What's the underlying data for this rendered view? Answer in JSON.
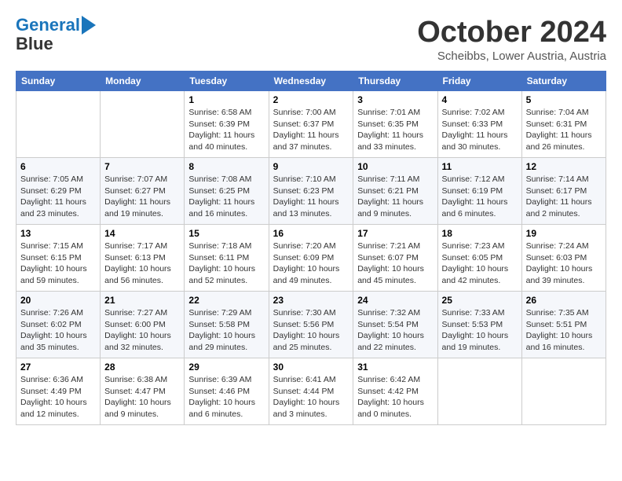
{
  "header": {
    "logo_line1": "General",
    "logo_line2": "Blue",
    "month": "October 2024",
    "location": "Scheibbs, Lower Austria, Austria"
  },
  "weekdays": [
    "Sunday",
    "Monday",
    "Tuesday",
    "Wednesday",
    "Thursday",
    "Friday",
    "Saturday"
  ],
  "weeks": [
    [
      {
        "day": "",
        "info": ""
      },
      {
        "day": "",
        "info": ""
      },
      {
        "day": "1",
        "info": "Sunrise: 6:58 AM\nSunset: 6:39 PM\nDaylight: 11 hours and 40 minutes."
      },
      {
        "day": "2",
        "info": "Sunrise: 7:00 AM\nSunset: 6:37 PM\nDaylight: 11 hours and 37 minutes."
      },
      {
        "day": "3",
        "info": "Sunrise: 7:01 AM\nSunset: 6:35 PM\nDaylight: 11 hours and 33 minutes."
      },
      {
        "day": "4",
        "info": "Sunrise: 7:02 AM\nSunset: 6:33 PM\nDaylight: 11 hours and 30 minutes."
      },
      {
        "day": "5",
        "info": "Sunrise: 7:04 AM\nSunset: 6:31 PM\nDaylight: 11 hours and 26 minutes."
      }
    ],
    [
      {
        "day": "6",
        "info": "Sunrise: 7:05 AM\nSunset: 6:29 PM\nDaylight: 11 hours and 23 minutes."
      },
      {
        "day": "7",
        "info": "Sunrise: 7:07 AM\nSunset: 6:27 PM\nDaylight: 11 hours and 19 minutes."
      },
      {
        "day": "8",
        "info": "Sunrise: 7:08 AM\nSunset: 6:25 PM\nDaylight: 11 hours and 16 minutes."
      },
      {
        "day": "9",
        "info": "Sunrise: 7:10 AM\nSunset: 6:23 PM\nDaylight: 11 hours and 13 minutes."
      },
      {
        "day": "10",
        "info": "Sunrise: 7:11 AM\nSunset: 6:21 PM\nDaylight: 11 hours and 9 minutes."
      },
      {
        "day": "11",
        "info": "Sunrise: 7:12 AM\nSunset: 6:19 PM\nDaylight: 11 hours and 6 minutes."
      },
      {
        "day": "12",
        "info": "Sunrise: 7:14 AM\nSunset: 6:17 PM\nDaylight: 11 hours and 2 minutes."
      }
    ],
    [
      {
        "day": "13",
        "info": "Sunrise: 7:15 AM\nSunset: 6:15 PM\nDaylight: 10 hours and 59 minutes."
      },
      {
        "day": "14",
        "info": "Sunrise: 7:17 AM\nSunset: 6:13 PM\nDaylight: 10 hours and 56 minutes."
      },
      {
        "day": "15",
        "info": "Sunrise: 7:18 AM\nSunset: 6:11 PM\nDaylight: 10 hours and 52 minutes."
      },
      {
        "day": "16",
        "info": "Sunrise: 7:20 AM\nSunset: 6:09 PM\nDaylight: 10 hours and 49 minutes."
      },
      {
        "day": "17",
        "info": "Sunrise: 7:21 AM\nSunset: 6:07 PM\nDaylight: 10 hours and 45 minutes."
      },
      {
        "day": "18",
        "info": "Sunrise: 7:23 AM\nSunset: 6:05 PM\nDaylight: 10 hours and 42 minutes."
      },
      {
        "day": "19",
        "info": "Sunrise: 7:24 AM\nSunset: 6:03 PM\nDaylight: 10 hours and 39 minutes."
      }
    ],
    [
      {
        "day": "20",
        "info": "Sunrise: 7:26 AM\nSunset: 6:02 PM\nDaylight: 10 hours and 35 minutes."
      },
      {
        "day": "21",
        "info": "Sunrise: 7:27 AM\nSunset: 6:00 PM\nDaylight: 10 hours and 32 minutes."
      },
      {
        "day": "22",
        "info": "Sunrise: 7:29 AM\nSunset: 5:58 PM\nDaylight: 10 hours and 29 minutes."
      },
      {
        "day": "23",
        "info": "Sunrise: 7:30 AM\nSunset: 5:56 PM\nDaylight: 10 hours and 25 minutes."
      },
      {
        "day": "24",
        "info": "Sunrise: 7:32 AM\nSunset: 5:54 PM\nDaylight: 10 hours and 22 minutes."
      },
      {
        "day": "25",
        "info": "Sunrise: 7:33 AM\nSunset: 5:53 PM\nDaylight: 10 hours and 19 minutes."
      },
      {
        "day": "26",
        "info": "Sunrise: 7:35 AM\nSunset: 5:51 PM\nDaylight: 10 hours and 16 minutes."
      }
    ],
    [
      {
        "day": "27",
        "info": "Sunrise: 6:36 AM\nSunset: 4:49 PM\nDaylight: 10 hours and 12 minutes."
      },
      {
        "day": "28",
        "info": "Sunrise: 6:38 AM\nSunset: 4:47 PM\nDaylight: 10 hours and 9 minutes."
      },
      {
        "day": "29",
        "info": "Sunrise: 6:39 AM\nSunset: 4:46 PM\nDaylight: 10 hours and 6 minutes."
      },
      {
        "day": "30",
        "info": "Sunrise: 6:41 AM\nSunset: 4:44 PM\nDaylight: 10 hours and 3 minutes."
      },
      {
        "day": "31",
        "info": "Sunrise: 6:42 AM\nSunset: 4:42 PM\nDaylight: 10 hours and 0 minutes."
      },
      {
        "day": "",
        "info": ""
      },
      {
        "day": "",
        "info": ""
      }
    ]
  ]
}
